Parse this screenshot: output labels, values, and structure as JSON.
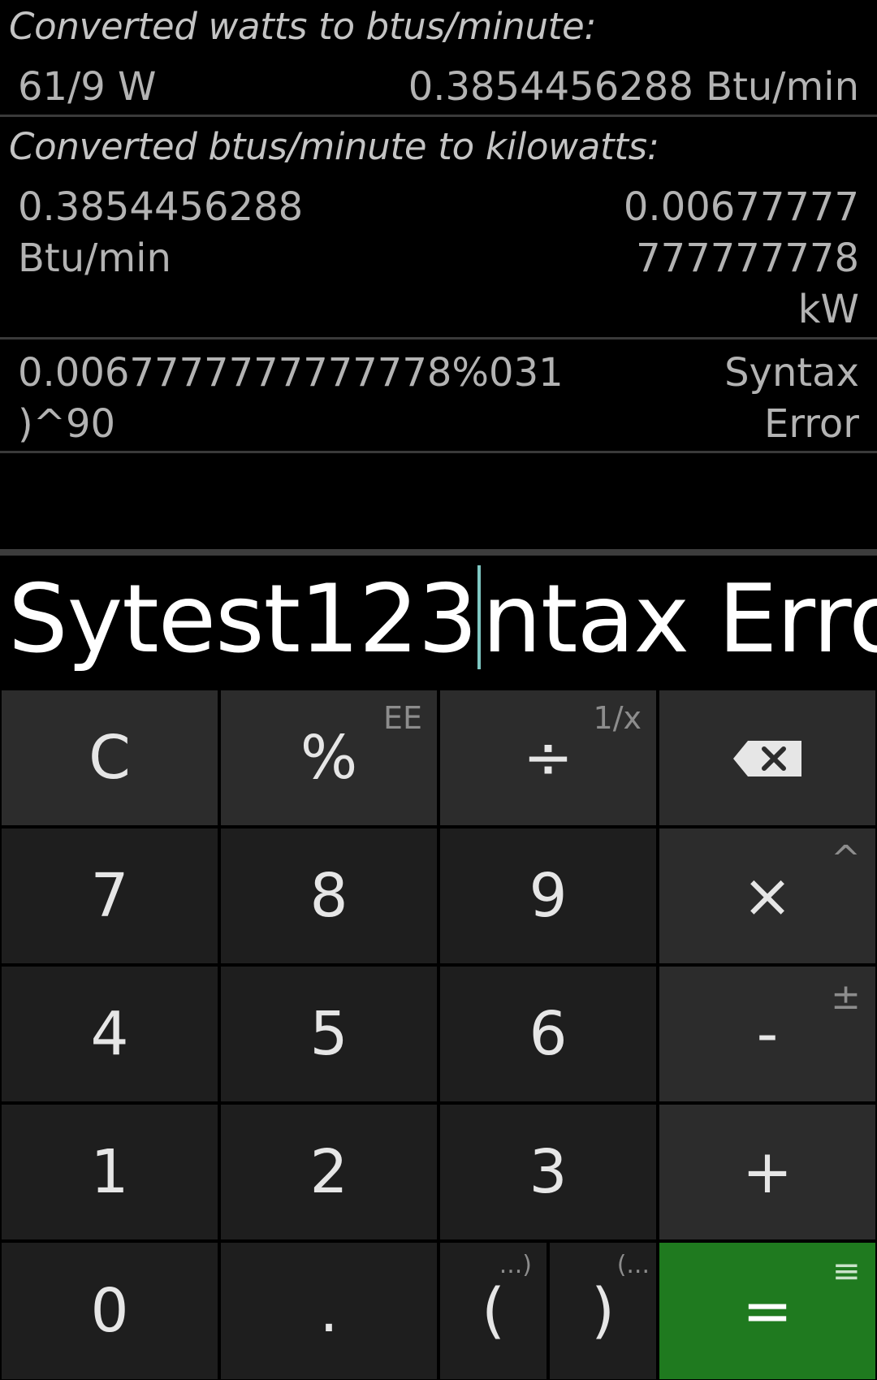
{
  "history": [
    {
      "title": "Converted watts to btus/minute:",
      "input": "61/9 W",
      "result": "0.3854456288 Btu/min"
    },
    {
      "title": "Converted btus/minute to kilowatts:",
      "input_line1": "0.3854456288",
      "input_line2": "Btu/min",
      "result_line1": "0.00677777",
      "result_line2": "777777778",
      "result_line3": "kW"
    },
    {
      "input_line1": "0.0067777777777778%031",
      "input_line2": ")^90",
      "result_line1": "Syntax",
      "result_line2": "Error"
    }
  ],
  "display": {
    "before_cursor": "Sytest123",
    "after_cursor": "ntax Error"
  },
  "keys": {
    "clear": "C",
    "percent": "%",
    "percent_alt": "EE",
    "divide": "÷",
    "divide_alt": "1/x",
    "backspace_icon": "backspace-icon",
    "seven": "7",
    "eight": "8",
    "nine": "9",
    "multiply": "×",
    "multiply_alt": "^",
    "four": "4",
    "five": "5",
    "six": "6",
    "minus": "-",
    "minus_alt": "±",
    "one": "1",
    "two": "2",
    "three": "3",
    "plus": "+",
    "zero": "0",
    "decimal": ".",
    "open_paren": "(",
    "open_paren_alt": "...)",
    "close_paren": ")",
    "close_paren_alt": "(...",
    "equals": "=",
    "equals_alt": "≡"
  },
  "colors": {
    "equals_key": "#1f7a1f",
    "cursor": "#7fc8c3",
    "top_row_key": "#2c2c2c",
    "number_key": "#1e1e1e"
  }
}
